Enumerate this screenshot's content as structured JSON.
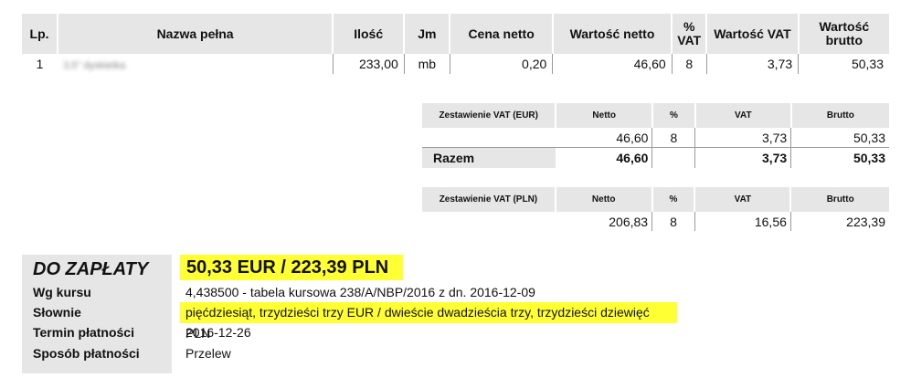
{
  "main_table": {
    "headers": [
      "Lp.",
      "Nazwa pełna",
      "Ilość",
      "Jm",
      "Cena netto",
      "Wartość netto",
      "% VAT",
      "Wartość VAT",
      "Wartość brutto"
    ],
    "rows": [
      [
        "1",
        "",
        "233,00",
        "mb",
        "0,20",
        "46,60",
        "8",
        "3,73",
        "50,33"
      ]
    ]
  },
  "vat_eur": {
    "headers": [
      "Zestawienie VAT (EUR)",
      "Netto",
      "%",
      "VAT",
      "Brutto"
    ],
    "row": [
      "46,60",
      "8",
      "3,73",
      "50,33"
    ],
    "sum": [
      "Razem",
      "46,60",
      "3,73",
      "50,33"
    ]
  },
  "vat_pln": {
    "headers": [
      "Zestawienie VAT (PLN)",
      "Netto",
      "%",
      "VAT",
      "Brutto"
    ],
    "row": [
      "206,83",
      "8",
      "16,56",
      "223,39"
    ]
  },
  "payment": {
    "title": "DO ZAPŁATY",
    "amount": "50,33 EUR / 223,39 PLN",
    "labels": [
      "Wg kursu",
      "Słownie",
      "Termin płatności",
      "Sposób płatności"
    ],
    "values": [
      "4,438500 - tabela kursowa 238/A/NBP/2016 z dn. 2016-12-09",
      "pięćdziesiąt, trzydzieści trzy EUR / dwieście dwadzieścia trzy, trzydzieści dziewięć PLN",
      "2016-12-26",
      "Przelew"
    ]
  },
  "colors": {
    "header_bg": "#e6e6e6",
    "highlight": "#ffff33"
  }
}
